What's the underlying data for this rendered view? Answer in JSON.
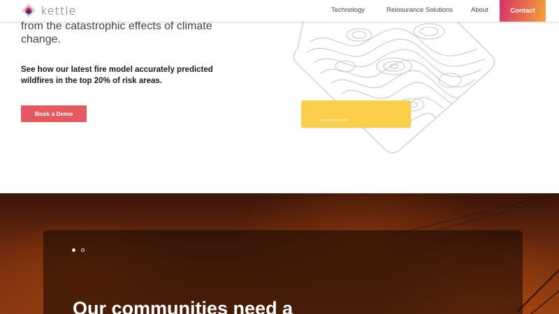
{
  "header": {
    "logo_text": "kettle",
    "nav": {
      "technology": "Technology",
      "reinsurance": "Reinsurance Solutions",
      "about": "About",
      "contact": "Contact"
    }
  },
  "hero": {
    "intro_text": "from the catastrophic effects of climate change.",
    "stat_text": "See how our latest fire model accurately predicted wildfires in the top 20% of risk areas.",
    "demo_button": "Book a Demo"
  },
  "carousel": {
    "heading": "Our communities need a",
    "dots": [
      "active",
      "inactive"
    ]
  },
  "colors": {
    "contact_gradient": [
      "#d6316b",
      "#f1a43a"
    ],
    "demo_button": "#e45a63",
    "yellow_card": "#fbcf4c",
    "fire_dark": "#3a1408"
  }
}
